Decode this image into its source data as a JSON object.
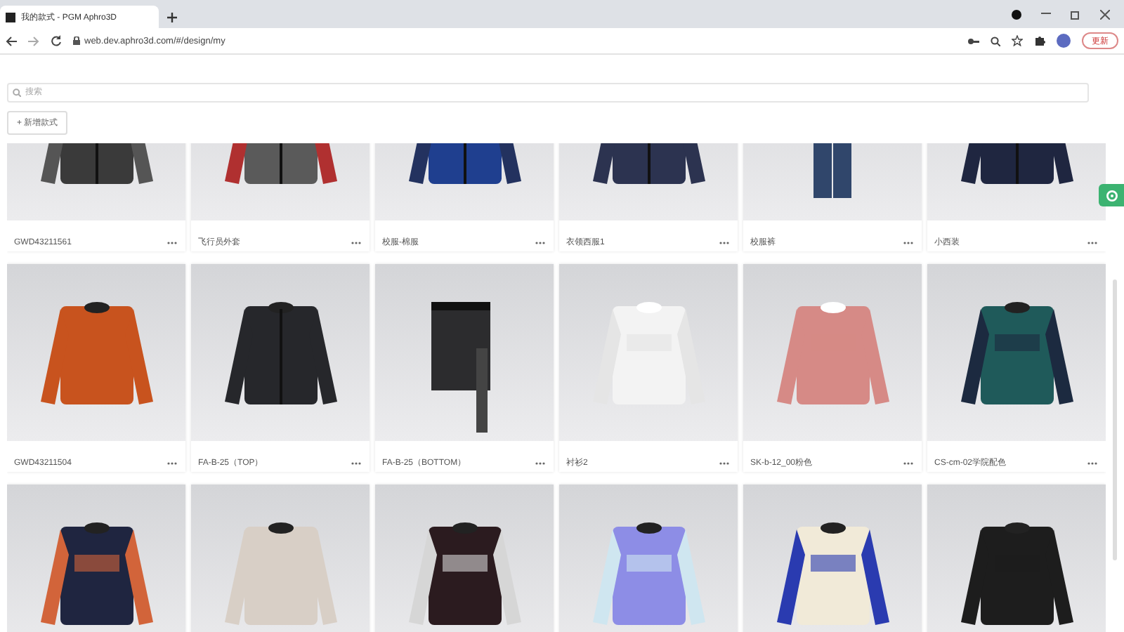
{
  "browser": {
    "tab_title": "我的款式 - PGM Aphro3D",
    "url": "web.dev.aphro3d.com/#/design/my",
    "update_button": "更新"
  },
  "search": {
    "placeholder": "搜索"
  },
  "new_button": "+ 新增款式",
  "cards": [
    {
      "kind": "card",
      "name": "GWD43211561"
    },
    {
      "kind": "card",
      "name": "飞行员外套"
    },
    {
      "kind": "card",
      "name": "校服-棉服"
    },
    {
      "kind": "card",
      "name": "衣领西服1"
    },
    {
      "kind": "card",
      "name": "校服裤"
    },
    {
      "kind": "card",
      "name": "小西装"
    },
    {
      "kind": "card",
      "name": "GWD43211504"
    },
    {
      "kind": "card",
      "name": "FA-B-25（TOP）"
    },
    {
      "kind": "card",
      "name": "FA-B-25（BOTTOM）"
    },
    {
      "kind": "card",
      "name": "衬衫2"
    },
    {
      "kind": "card",
      "name": "SK-b-12_00粉色"
    },
    {
      "kind": "card",
      "name": "CS-cm-02学院配色"
    },
    {
      "kind": "picture"
    },
    {
      "kind": "picture"
    },
    {
      "kind": "picture"
    },
    {
      "kind": "picture"
    },
    {
      "kind": "picture"
    },
    {
      "kind": "picture"
    }
  ]
}
